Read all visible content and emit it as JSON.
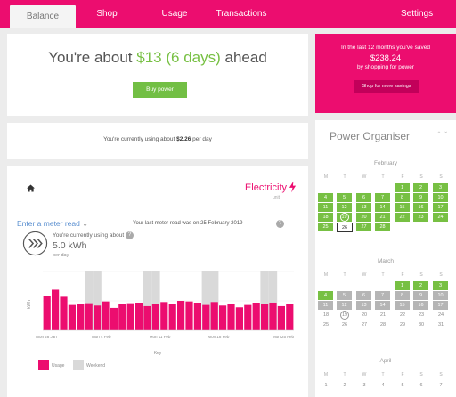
{
  "nav": {
    "tabs": [
      {
        "label": "Balance",
        "active": true
      },
      {
        "label": "Shop",
        "active": false
      },
      {
        "label": "Usage",
        "active": false
      },
      {
        "label": "Transactions",
        "active": false
      }
    ],
    "settings_label": "Settings"
  },
  "ahead": {
    "prefix": "You're about ",
    "amount": "$13",
    "days": "(6 days)",
    "suffix": " ahead",
    "button_label": "Buy power"
  },
  "savings": {
    "line1": "In the last 12 months you've saved",
    "amount": "$238.24",
    "line3": "by shopping for power",
    "button_label": "Shop for more savings"
  },
  "daily": {
    "prefix": "You're currently using about ",
    "amount": "$2.26",
    "suffix": " per day"
  },
  "usage": {
    "fuel": "Electricity",
    "unit_label": "unit",
    "using_text": "You're currently using about",
    "kwh": "5.0 kWh",
    "per_day": "per day",
    "key_label": "Key",
    "legend_usage": "Usage",
    "legend_weekend": "Weekend",
    "enter_meter": "Enter a meter read",
    "last_read": "Your last meter read was on 25 February 2019"
  },
  "chart_data": {
    "type": "bar",
    "ylabel": "kWh",
    "x_tick_labels": [
      "Mon 28 Jan",
      "Mon 4 Feb",
      "Mon 11 Feb",
      "Mon 18 Feb",
      "Mon 25 Feb"
    ],
    "values": [
      5.8,
      6.9,
      5.7,
      4.3,
      4.4,
      4.6,
      4.2,
      4.9,
      3.8,
      4.5,
      4.6,
      4.7,
      4.1,
      4.5,
      4.8,
      4.4,
      5.0,
      4.9,
      4.7,
      4.3,
      4.8,
      4.2,
      4.5,
      3.9,
      4.3,
      4.7,
      4.5,
      4.7,
      4.1,
      4.4
    ],
    "weekend_indices": [
      5,
      6,
      12,
      13,
      19,
      20,
      26,
      27
    ],
    "ylim": [
      0,
      10
    ],
    "colors": {
      "usage": "#ec0d6f",
      "weekend": "#d9d9d9"
    }
  },
  "organiser": {
    "title": "Power Organiser",
    "weekdays": [
      "M",
      "T",
      "W",
      "T",
      "F",
      "S",
      "S"
    ],
    "months": [
      {
        "name": "February",
        "rows": [
          [
            "",
            "",
            "",
            "",
            "1",
            "2",
            "3"
          ],
          [
            "4",
            "5",
            "6",
            "7",
            "8",
            "9",
            "10"
          ],
          [
            "11",
            "12",
            "13",
            "14",
            "15",
            "16",
            "17"
          ],
          [
            "18",
            "19",
            "20",
            "21",
            "22",
            "23",
            "24"
          ],
          [
            "25",
            "26",
            "27",
            "28",
            "",
            "",
            ""
          ]
        ],
        "styles": [
          [
            "",
            "",
            "",
            "",
            "green",
            "green",
            "green"
          ],
          [
            "green",
            "green",
            "green",
            "green",
            "green",
            "green",
            "green"
          ],
          [
            "green",
            "green",
            "green",
            "green",
            "green",
            "green",
            "green"
          ],
          [
            "green",
            "circle-green",
            "green",
            "green",
            "green",
            "green",
            "green"
          ],
          [
            "green",
            "box",
            "green",
            "green",
            "",
            "",
            ""
          ]
        ]
      },
      {
        "name": "March",
        "rows": [
          [
            "",
            "",
            "",
            "",
            "1",
            "2",
            "3"
          ],
          [
            "4",
            "5",
            "6",
            "7",
            "8",
            "9",
            "10"
          ],
          [
            "11",
            "12",
            "13",
            "14",
            "15",
            "16",
            "17"
          ],
          [
            "18",
            "19",
            "20",
            "21",
            "22",
            "23",
            "24"
          ],
          [
            "25",
            "26",
            "27",
            "28",
            "29",
            "30",
            "31"
          ]
        ],
        "styles": [
          [
            "",
            "",
            "",
            "",
            "green",
            "green",
            "green"
          ],
          [
            "green",
            "grey",
            "grey",
            "grey",
            "grey",
            "grey",
            "grey"
          ],
          [
            "grey",
            "grey",
            "grey",
            "grey",
            "grey",
            "grey",
            "grey"
          ],
          [
            "",
            "circle",
            "",
            "",
            "",
            "",
            ""
          ],
          [
            "",
            "",
            "",
            "",
            "",
            "",
            ""
          ]
        ]
      },
      {
        "name": "April",
        "rows": [
          [
            "1",
            "2",
            "3",
            "4",
            "5",
            "6",
            "7"
          ]
        ],
        "styles": [
          [
            "",
            "",
            "",
            "",
            "",
            "",
            ""
          ]
        ]
      }
    ]
  },
  "colors": {
    "brand": "#ec0d6f",
    "green": "#77c043",
    "link": "#5a8fd0"
  }
}
